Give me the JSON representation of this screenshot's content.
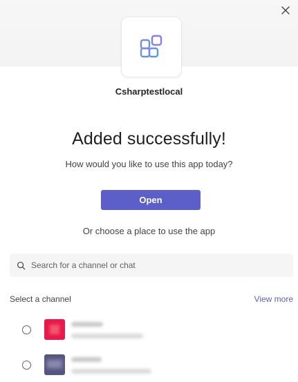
{
  "dialog": {
    "close_label": "×",
    "app_name": "Csharptestlocal",
    "heading": "Added successfully!",
    "subheading": "How would you like to use this app today?",
    "open_button": "Open",
    "choose_text": "Or choose a place to use the app",
    "search": {
      "placeholder": "Search for a channel or chat",
      "value": ""
    },
    "section_label": "Select a channel",
    "view_more": "View more"
  },
  "channels": [
    {
      "icon": "channel-thumbnail-red",
      "color": "#e8194b"
    },
    {
      "icon": "channel-thumbnail-purple",
      "color": "#5b5b86"
    }
  ],
  "colors": {
    "accent": "#5b5fc7",
    "text": "#242424"
  }
}
